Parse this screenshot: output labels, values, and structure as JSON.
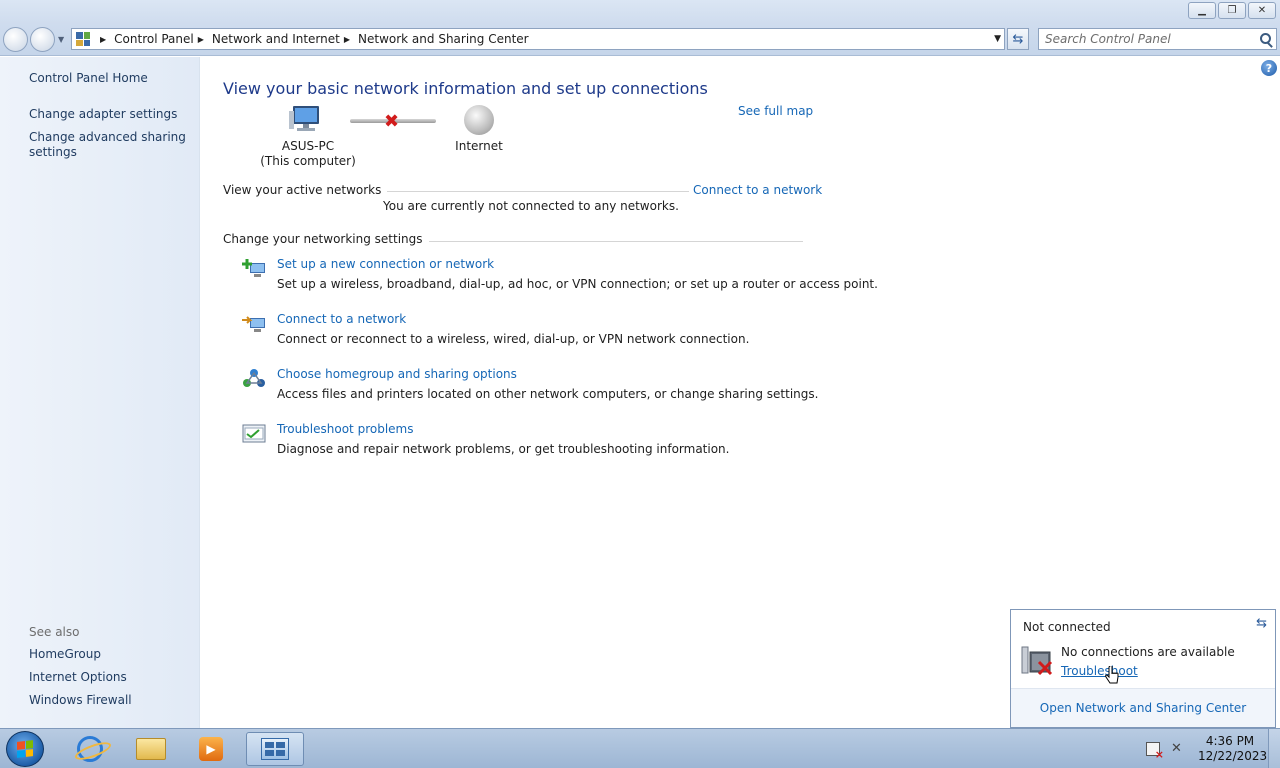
{
  "window": {
    "minimize_icon": "minimize-icon",
    "maximize_icon": "restore-icon",
    "close_icon": "close-icon"
  },
  "address_bar": {
    "breadcrumbs": [
      "Control Panel",
      "Network and Internet",
      "Network and Sharing Center"
    ],
    "search_placeholder": "Search Control Panel"
  },
  "sidebar": {
    "items": [
      {
        "label": "Control Panel Home"
      },
      {
        "label": "Change adapter settings"
      },
      {
        "label": "Change advanced sharing settings"
      }
    ],
    "see_also_label": "See also",
    "see_also": [
      {
        "label": "HomeGroup"
      },
      {
        "label": "Internet Options"
      },
      {
        "label": "Windows Firewall"
      }
    ]
  },
  "main": {
    "heading": "View your basic network information and set up connections",
    "see_full_map": "See full map",
    "map": {
      "computer_name": "ASUS-PC",
      "computer_sub": "(This computer)",
      "internet_label": "Internet"
    },
    "active_networks": {
      "title": "View your active networks",
      "connect_link": "Connect to a network",
      "status": "You are currently not connected to any networks."
    },
    "settings": {
      "title": "Change your networking settings",
      "tasks": [
        {
          "title": "Set up a new connection or network",
          "desc": "Set up a wireless, broadband, dial-up, ad hoc, or VPN connection; or set up a router or access point."
        },
        {
          "title": "Connect to a network",
          "desc": "Connect or reconnect to a wireless, wired, dial-up, or VPN network connection."
        },
        {
          "title": "Choose homegroup and sharing options",
          "desc": "Access files and printers located on other network computers, or change sharing settings."
        },
        {
          "title": "Troubleshoot problems",
          "desc": "Diagnose and repair network problems, or get troubleshooting information."
        }
      ]
    }
  },
  "flyout": {
    "title": "Not connected",
    "message": "No connections are available",
    "troubleshoot": "Troubleshoot",
    "open_center": "Open Network and Sharing Center"
  },
  "taskbar": {
    "time": "4:36 PM",
    "date": "12/22/2023"
  },
  "colors": {
    "link": "#1667b6",
    "heading": "#1e3a8a",
    "error_red": "#d11b1b",
    "sidebar_bg": "#e6eef8"
  }
}
